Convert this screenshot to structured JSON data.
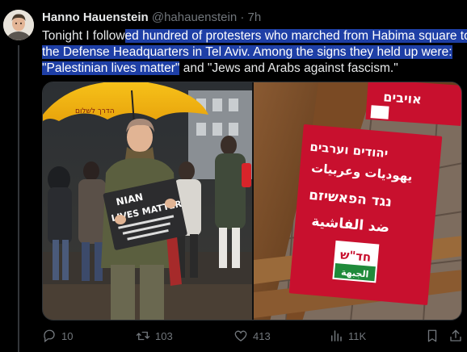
{
  "author": {
    "name": "Hanno Hauenstein",
    "handle": "@hahauenstein",
    "separator": "·",
    "time": "7h"
  },
  "tweet": {
    "line1_pre": "Tonight I follow",
    "line1_sel": "ed hundred of protesters who marched from Habima square to",
    "line2": "the Defense Headquarters in Tel Aviv. Among the signs they held up were:",
    "line3_sel": "\"Palestinian lives matter\"",
    "line3_post": " and \"Jews and Arabs against fascism.\""
  },
  "media": {
    "left_sign_en": "LIVES MATTER",
    "left_sign_top": "NIAN",
    "right_top_he": "אויבים",
    "right_sign_he1": "יהודים וערבים",
    "right_sign_ar1": "يهوديات وعربيات",
    "right_sign_he2": "נגד הפאשיזם",
    "right_sign_ar2": "ضد الفاشية",
    "logo_he": "חד\"ש",
    "logo_ar": "الجبهة",
    "umbrella_text": "הדרך לשלום"
  },
  "actions": {
    "replies": "10",
    "reposts": "103",
    "likes": "413",
    "views": "11K"
  },
  "colors": {
    "background": "#000000",
    "text": "#e7e9ea",
    "muted": "#71767b",
    "selection": "#1e3fa6",
    "sign_red": "#c8102e"
  }
}
